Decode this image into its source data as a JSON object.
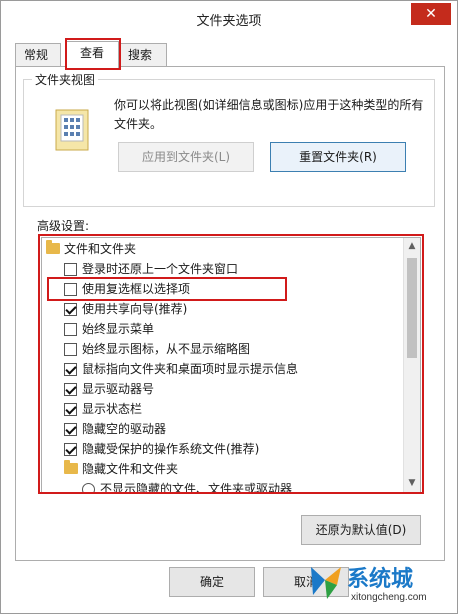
{
  "window": {
    "title": "文件夹选项",
    "close_glyph": "✕"
  },
  "tabs": [
    {
      "label": "常规"
    },
    {
      "label": "查看"
    },
    {
      "label": "搜索"
    }
  ],
  "folder_views": {
    "title": "文件夹视图",
    "description": "你可以将此视图(如详细信息或图标)应用于这种类型的所有文件夹。",
    "apply_button": "应用到文件夹(L)",
    "reset_button": "重置文件夹(R)"
  },
  "advanced": {
    "label": "高级设置:",
    "items": [
      {
        "type": "folder",
        "label": "文件和文件夹"
      },
      {
        "type": "checkbox",
        "checked": false,
        "label": "登录时还原上一个文件夹窗口"
      },
      {
        "type": "checkbox",
        "checked": false,
        "label": "使用复选框以选择项"
      },
      {
        "type": "checkbox",
        "checked": true,
        "label": "使用共享向导(推荐)"
      },
      {
        "type": "checkbox",
        "checked": false,
        "label": "始终显示菜单"
      },
      {
        "type": "checkbox",
        "checked": false,
        "label": "始终显示图标，从不显示缩略图"
      },
      {
        "type": "checkbox",
        "checked": true,
        "label": "鼠标指向文件夹和桌面项时显示提示信息"
      },
      {
        "type": "checkbox",
        "checked": true,
        "label": "显示驱动器号"
      },
      {
        "type": "checkbox",
        "checked": true,
        "label": "显示状态栏"
      },
      {
        "type": "checkbox",
        "checked": true,
        "label": "隐藏空的驱动器"
      },
      {
        "type": "checkbox",
        "checked": true,
        "label": "隐藏受保护的操作系统文件(推荐)"
      },
      {
        "type": "folder",
        "label": "隐藏文件和文件夹"
      },
      {
        "type": "radio",
        "checked": false,
        "label": "不显示隐藏的文件、文件夹或驱动器"
      }
    ]
  },
  "buttons": {
    "restore_defaults": "还原为默认值(D)",
    "ok": "确定",
    "cancel": "取消"
  },
  "watermark": {
    "text": "系统城",
    "sub": "xitongcheng.com"
  },
  "colors": {
    "highlight": "#d11a1a",
    "close": "#c42b1c",
    "watermark": "#1b79c8"
  }
}
